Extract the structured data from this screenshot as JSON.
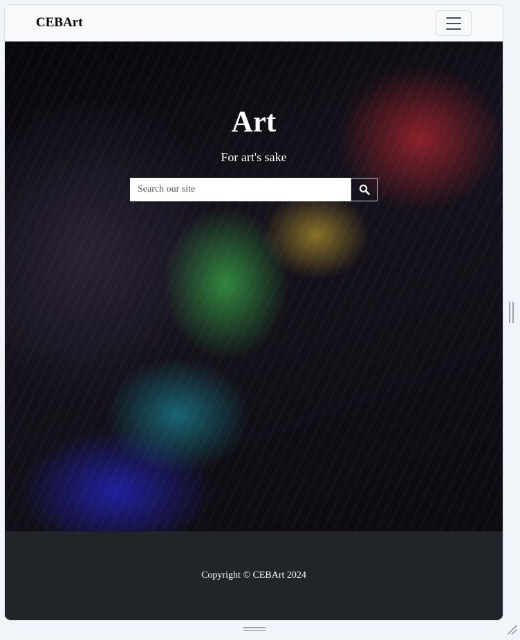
{
  "navbar": {
    "brand": "CEBArt",
    "toggle_icon": "hamburger-menu-icon"
  },
  "hero": {
    "title": "Art",
    "subtitle": "For art's sake",
    "search": {
      "placeholder": "Search our site",
      "value": "",
      "button_icon": "search-icon"
    }
  },
  "footer": {
    "copyright": "Copyright © CEBArt 2024"
  },
  "colors": {
    "navbar_bg": "#f8f9fa",
    "footer_bg": "#212529",
    "hero_text": "#ffffff"
  }
}
